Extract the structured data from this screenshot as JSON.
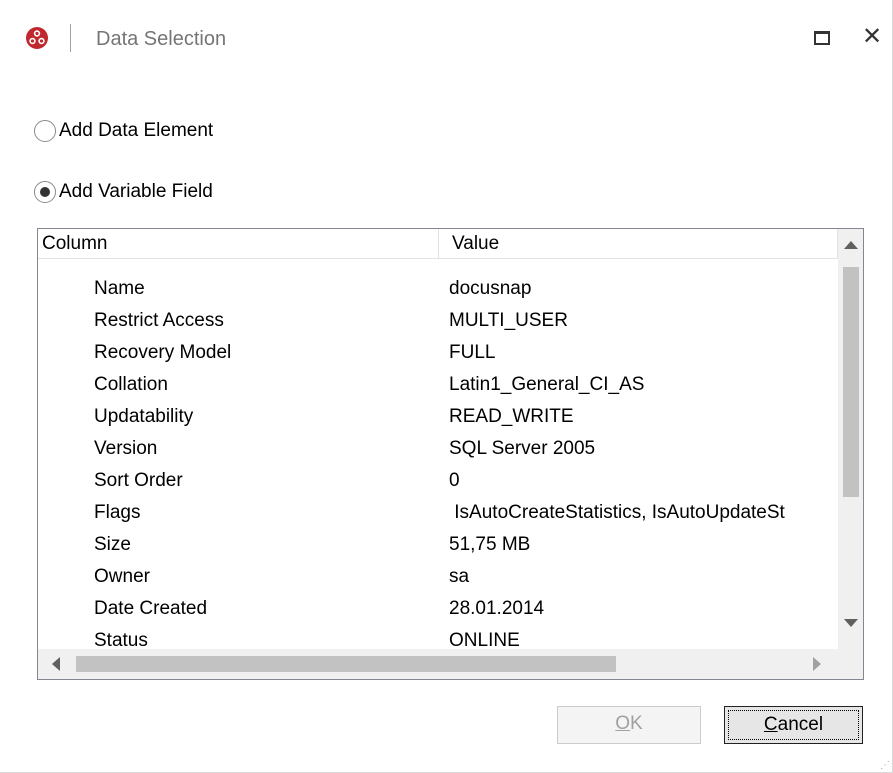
{
  "window": {
    "title": "Data Selection",
    "app_icon": "docusnap-logo-icon",
    "accent_color": "#c0282e"
  },
  "options": {
    "add_data_element": {
      "label": "Add Data Element",
      "checked": false
    },
    "add_variable_field": {
      "label": "Add Variable Field",
      "checked": true
    }
  },
  "grid": {
    "columns": [
      "Column",
      "Value"
    ],
    "rows": [
      {
        "column": "Name",
        "value": "docusnap"
      },
      {
        "column": "Restrict Access",
        "value": "MULTI_USER"
      },
      {
        "column": "Recovery Model",
        "value": "FULL"
      },
      {
        "column": "Collation",
        "value": "Latin1_General_CI_AS"
      },
      {
        "column": "Updatability",
        "value": "READ_WRITE"
      },
      {
        "column": "Version",
        "value": "SQL Server 2005"
      },
      {
        "column": "Sort Order",
        "value": "0"
      },
      {
        "column": "Flags",
        "value": " IsAutoCreateStatistics, IsAutoUpdateSt"
      },
      {
        "column": "Size",
        "value": "51,75 MB"
      },
      {
        "column": "Owner",
        "value": "sa"
      },
      {
        "column": "Date Created",
        "value": "28.01.2014"
      },
      {
        "column": "Status",
        "value": "ONLINE"
      }
    ]
  },
  "buttons": {
    "ok": {
      "label_mnemonic": "O",
      "label_rest": "K",
      "enabled": false
    },
    "cancel": {
      "label_mnemonic": "C",
      "label_rest": "ancel",
      "enabled": true
    }
  }
}
